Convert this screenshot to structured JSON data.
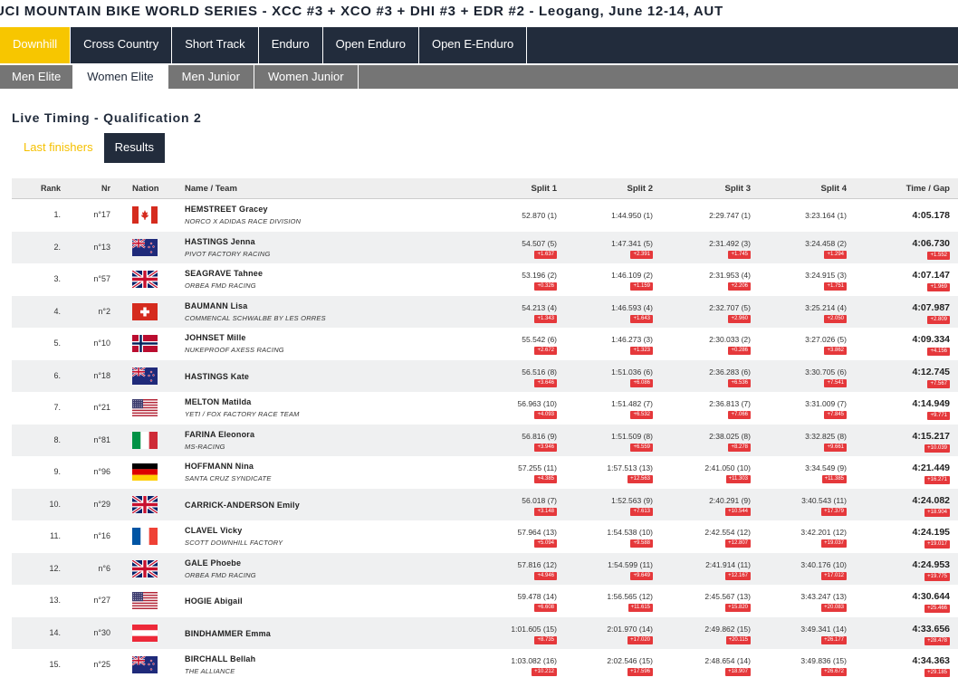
{
  "page": {
    "title": "UCI MOUNTAIN BIKE WORLD SERIES - XCC #3 + XCO #3 + DHI #3 + EDR #2 - Leogang, June 12-14, AUT"
  },
  "discipline_tabs": [
    {
      "label": "Downhill",
      "active": true
    },
    {
      "label": "Cross Country",
      "active": false
    },
    {
      "label": "Short Track",
      "active": false
    },
    {
      "label": "Enduro",
      "active": false
    },
    {
      "label": "Open Enduro",
      "active": false
    },
    {
      "label": "Open E-Enduro",
      "active": false
    }
  ],
  "category_tabs": [
    {
      "label": "Men Elite",
      "active": false
    },
    {
      "label": "Women Elite",
      "active": true
    },
    {
      "label": "Men Junior",
      "active": false
    },
    {
      "label": "Women Junior",
      "active": false
    }
  ],
  "section": {
    "title": "Live Timing - Qualification 2",
    "sub_tabs": [
      {
        "label": "Last finishers",
        "active": false
      },
      {
        "label": "Results",
        "active": true
      }
    ]
  },
  "table": {
    "headers": {
      "rank": "Rank",
      "nr": "Nr",
      "nation": "Nation",
      "name": "Name / Team",
      "split1": "Split 1",
      "split2": "Split 2",
      "split3": "Split 3",
      "split4": "Split 4",
      "time": "Time / Gap"
    },
    "rows": [
      {
        "rank": "1.",
        "nr": "n°17",
        "nation": "can",
        "name": "HEMSTREET Gracey",
        "team": "NORCO X ADIDAS RACE DIVISION",
        "s1": "52.870 (1)",
        "g1": "",
        "s2": "1:44.950 (1)",
        "g2": "",
        "s3": "2:29.747 (1)",
        "g3": "",
        "s4": "3:23.164 (1)",
        "g4": "",
        "time": "4:05.178",
        "gap": ""
      },
      {
        "rank": "2.",
        "nr": "n°13",
        "nation": "nzl",
        "name": "HASTINGS Jenna",
        "team": "PIVOT FACTORY RACING",
        "s1": "54.507 (5)",
        "g1": "+1.637",
        "s2": "1:47.341 (5)",
        "g2": "+2.391",
        "s3": "2:31.492 (3)",
        "g3": "+1.745",
        "s4": "3:24.458 (2)",
        "g4": "+1.294",
        "time": "4:06.730",
        "gap": "+1.552"
      },
      {
        "rank": "3.",
        "nr": "n°57",
        "nation": "gbr",
        "name": "SEAGRAVE Tahnee",
        "team": "ORBEA FMD RACING",
        "s1": "53.196 (2)",
        "g1": "+0.326",
        "s2": "1:46.109 (2)",
        "g2": "+1.159",
        "s3": "2:31.953 (4)",
        "g3": "+2.206",
        "s4": "3:24.915 (3)",
        "g4": "+1.751",
        "time": "4:07.147",
        "gap": "+1.969"
      },
      {
        "rank": "4.",
        "nr": "n°2",
        "nation": "sui",
        "name": "BAUMANN Lisa",
        "team": "COMMENCAL SCHWALBE BY LES ORRES",
        "s1": "54.213 (4)",
        "g1": "+1.343",
        "s2": "1:46.593 (4)",
        "g2": "+1.643",
        "s3": "2:32.707 (5)",
        "g3": "+2.960",
        "s4": "3:25.214 (4)",
        "g4": "+2.050",
        "time": "4:07.987",
        "gap": "+2.809"
      },
      {
        "rank": "5.",
        "nr": "n°10",
        "nation": "nor",
        "name": "JOHNSET Mille",
        "team": "NUKEPROOF AXESS RACING",
        "s1": "55.542 (6)",
        "g1": "+2.672",
        "s2": "1:46.273 (3)",
        "g2": "+1.323",
        "s3": "2:30.033 (2)",
        "g3": "+0.286",
        "s4": "3:27.026 (5)",
        "g4": "+3.862",
        "time": "4:09.334",
        "gap": "+4.156"
      },
      {
        "rank": "6.",
        "nr": "n°18",
        "nation": "nzl",
        "name": "HASTINGS Kate",
        "team": "",
        "s1": "56.516 (8)",
        "g1": "+3.646",
        "s2": "1:51.036 (6)",
        "g2": "+6.086",
        "s3": "2:36.283 (6)",
        "g3": "+6.536",
        "s4": "3:30.705 (6)",
        "g4": "+7.541",
        "time": "4:12.745",
        "gap": "+7.567"
      },
      {
        "rank": "7.",
        "nr": "n°21",
        "nation": "usa",
        "name": "MELTON Matilda",
        "team": "YETI / FOX FACTORY RACE TEAM",
        "s1": "56.963 (10)",
        "g1": "+4.093",
        "s2": "1:51.482 (7)",
        "g2": "+6.532",
        "s3": "2:36.813 (7)",
        "g3": "+7.066",
        "s4": "3:31.009 (7)",
        "g4": "+7.845",
        "time": "4:14.949",
        "gap": "+9.771"
      },
      {
        "rank": "8.",
        "nr": "n°81",
        "nation": "ita",
        "name": "FARINA Eleonora",
        "team": "MS-RACING",
        "s1": "56.816 (9)",
        "g1": "+3.946",
        "s2": "1:51.509 (8)",
        "g2": "+6.559",
        "s3": "2:38.025 (8)",
        "g3": "+8.278",
        "s4": "3:32.825 (8)",
        "g4": "+9.661",
        "time": "4:15.217",
        "gap": "+10.039"
      },
      {
        "rank": "9.",
        "nr": "n°96",
        "nation": "ger",
        "name": "HOFFMANN Nina",
        "team": "SANTA CRUZ SYNDICATE",
        "s1": "57.255 (11)",
        "g1": "+4.385",
        "s2": "1:57.513 (13)",
        "g2": "+12.563",
        "s3": "2:41.050 (10)",
        "g3": "+11.303",
        "s4": "3:34.549 (9)",
        "g4": "+11.385",
        "time": "4:21.449",
        "gap": "+16.271"
      },
      {
        "rank": "10.",
        "nr": "n°29",
        "nation": "gbr",
        "name": "CARRICK-ANDERSON Emily",
        "team": "",
        "s1": "56.018 (7)",
        "g1": "+3.148",
        "s2": "1:52.563 (9)",
        "g2": "+7.613",
        "s3": "2:40.291 (9)",
        "g3": "+10.544",
        "s4": "3:40.543 (11)",
        "g4": "+17.379",
        "time": "4:24.082",
        "gap": "+18.904"
      },
      {
        "rank": "11.",
        "nr": "n°16",
        "nation": "fra",
        "name": "CLAVEL Vicky",
        "team": "SCOTT DOWNHILL FACTORY",
        "s1": "57.964 (13)",
        "g1": "+5.094",
        "s2": "1:54.538 (10)",
        "g2": "+9.588",
        "s3": "2:42.554 (12)",
        "g3": "+12.807",
        "s4": "3:42.201 (12)",
        "g4": "+19.037",
        "time": "4:24.195",
        "gap": "+19.017"
      },
      {
        "rank": "12.",
        "nr": "n°6",
        "nation": "gbr",
        "name": "GALE Phoebe",
        "team": "ORBEA FMD RACING",
        "s1": "57.816 (12)",
        "g1": "+4.946",
        "s2": "1:54.599 (11)",
        "g2": "+9.649",
        "s3": "2:41.914 (11)",
        "g3": "+12.167",
        "s4": "3:40.176 (10)",
        "g4": "+17.012",
        "time": "4:24.953",
        "gap": "+19.775"
      },
      {
        "rank": "13.",
        "nr": "n°27",
        "nation": "usa",
        "name": "HOGIE Abigail",
        "team": "",
        "s1": "59.478 (14)",
        "g1": "+6.608",
        "s2": "1:56.565 (12)",
        "g2": "+11.615",
        "s3": "2:45.567 (13)",
        "g3": "+15.820",
        "s4": "3:43.247 (13)",
        "g4": "+20.083",
        "time": "4:30.644",
        "gap": "+25.466"
      },
      {
        "rank": "14.",
        "nr": "n°30",
        "nation": "aut",
        "name": "BINDHAMMER Emma",
        "team": "",
        "s1": "1:01.605 (15)",
        "g1": "+8.735",
        "s2": "2:01.970 (14)",
        "g2": "+17.020",
        "s3": "2:49.862 (15)",
        "g3": "+20.115",
        "s4": "3:49.341 (14)",
        "g4": "+26.177",
        "time": "4:33.656",
        "gap": "+28.478"
      },
      {
        "rank": "15.",
        "nr": "n°25",
        "nation": "nzl",
        "name": "BIRCHALL Bellah",
        "team": "THE ALLIANCE",
        "s1": "1:03.082 (16)",
        "g1": "+10.212",
        "s2": "2:02.546 (15)",
        "g2": "+17.596",
        "s3": "2:48.654 (14)",
        "g3": "+18.907",
        "s4": "3:49.836 (15)",
        "g4": "+26.672",
        "time": "4:34.363",
        "gap": "+29.185"
      }
    ]
  },
  "colors": {
    "nav_bg": "#222c3c",
    "accent_yellow": "#f7c600",
    "category_bar": "#757575",
    "gap_badge": "#e5383b",
    "row_alt": "#eff0f1"
  }
}
